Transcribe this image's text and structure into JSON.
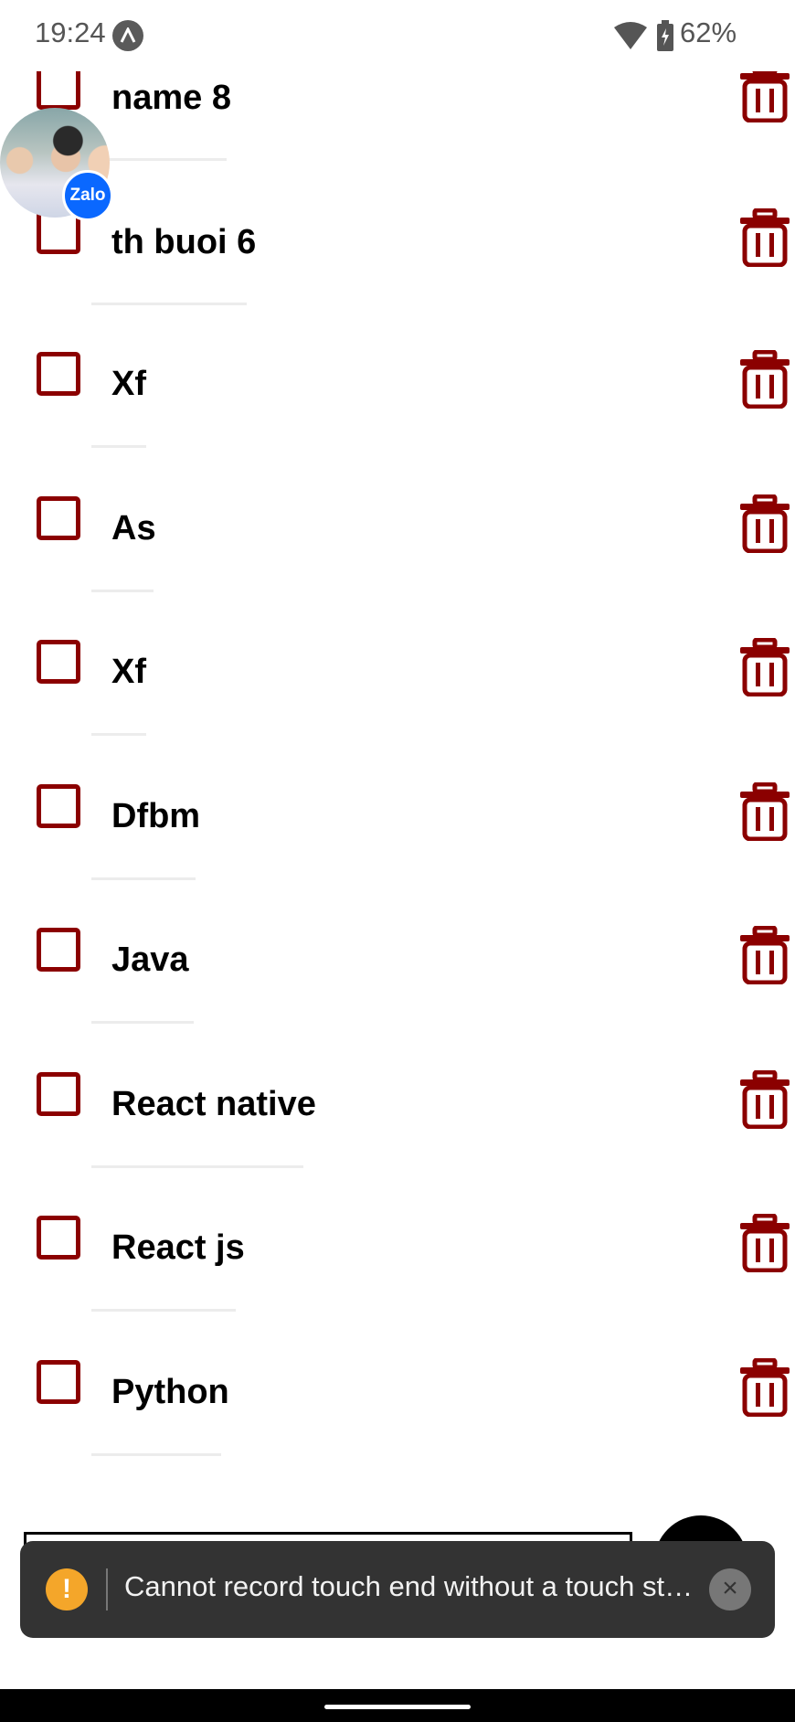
{
  "status_bar": {
    "time": "19:24",
    "battery": "62%"
  },
  "items": [
    {
      "label": "name 8"
    },
    {
      "label": "th buoi 6"
    },
    {
      "label": "Xf"
    },
    {
      "label": "As"
    },
    {
      "label": "Xf"
    },
    {
      "label": "Dfbm"
    },
    {
      "label": "Java"
    },
    {
      "label": "React native"
    },
    {
      "label": "React js"
    },
    {
      "label": "Python"
    }
  ],
  "chat_bubble": {
    "badge": "Zalo"
  },
  "toast": {
    "message": "Cannot record touch end without a touch st…",
    "warning_symbol": "!",
    "close_symbol": "×"
  },
  "colors": {
    "accent": "#8b0000",
    "toast_bg": "#333333",
    "warning": "#f4a62a"
  },
  "icons": [
    "wifi-icon",
    "battery-icon",
    "trash-icon",
    "warning-icon",
    "close-icon"
  ]
}
